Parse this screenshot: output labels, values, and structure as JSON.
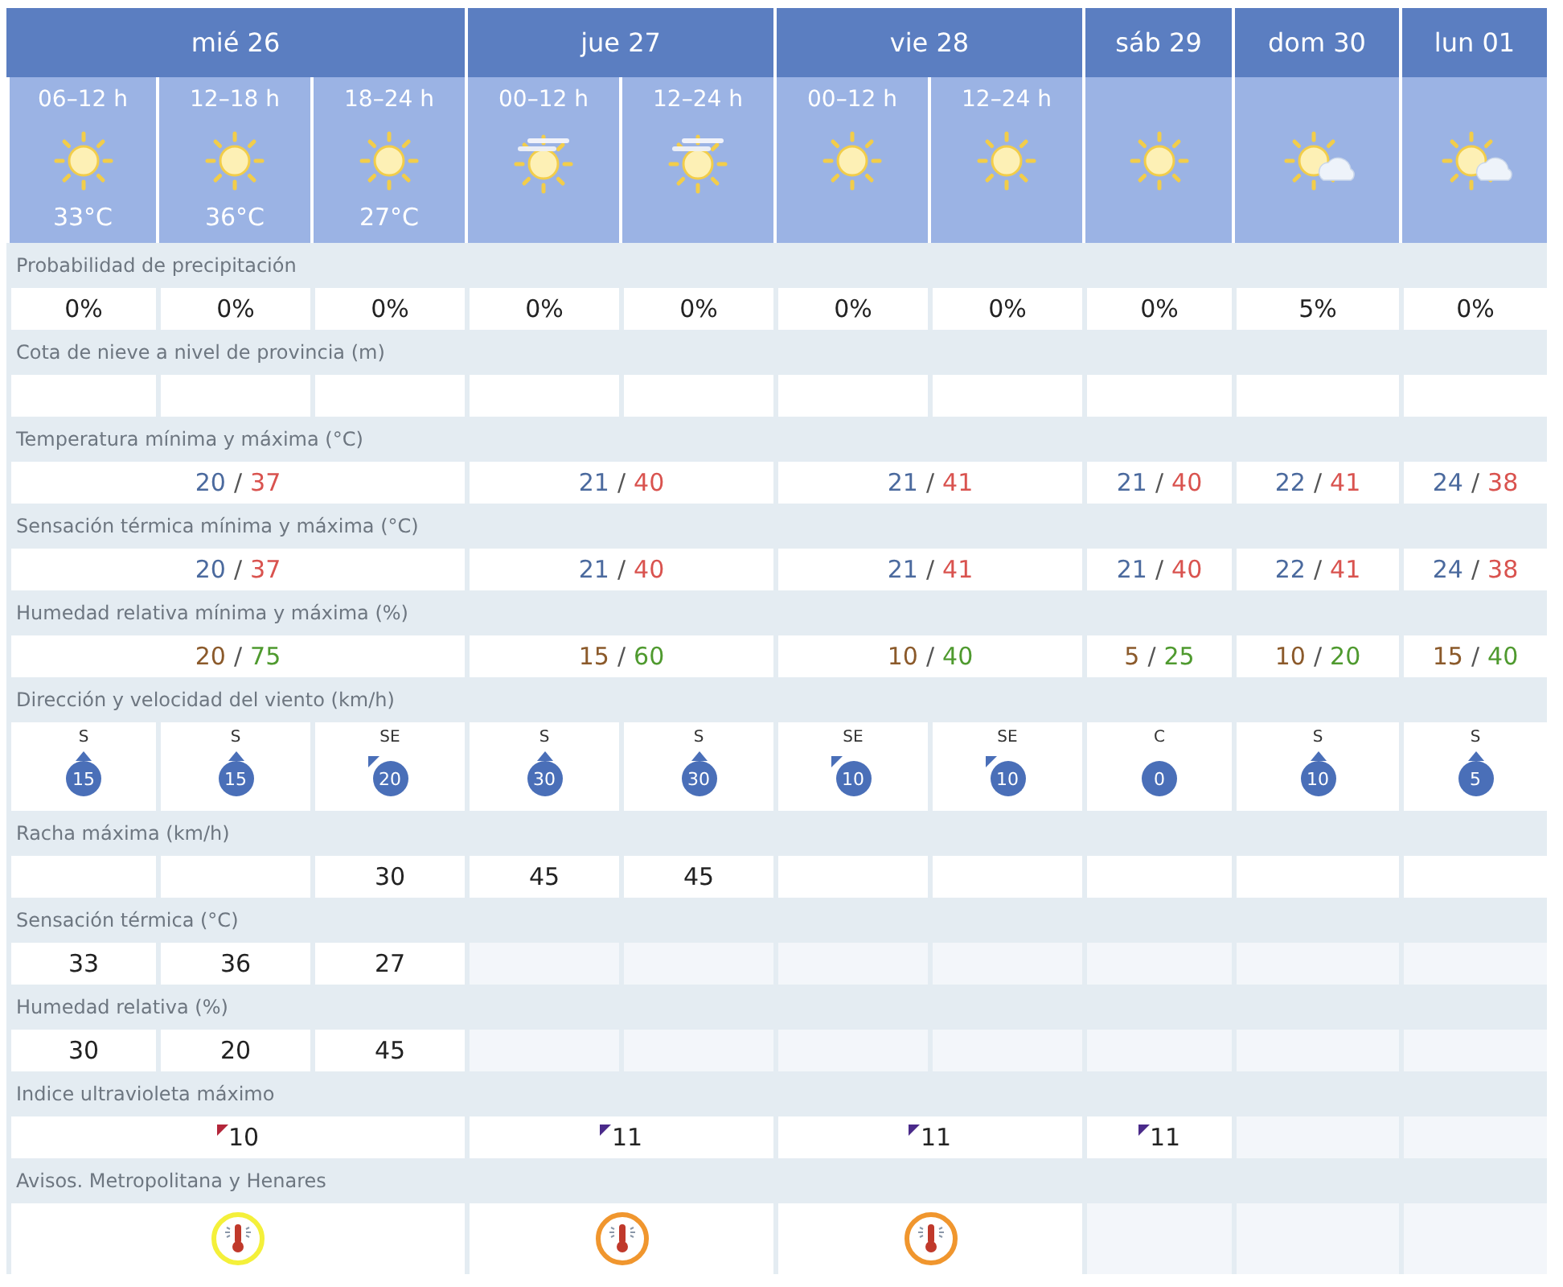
{
  "days": [
    {
      "label": "mié 26",
      "periods": [
        {
          "label": "06–12 h",
          "kind": "sunny",
          "temp": "33°C"
        },
        {
          "label": "12–18 h",
          "kind": "sunny",
          "temp": "36°C"
        },
        {
          "label": "18–24 h",
          "kind": "sunny",
          "temp": "27°C"
        }
      ]
    },
    {
      "label": "jue 27",
      "periods": [
        {
          "label": "00–12 h",
          "kind": "hazy"
        },
        {
          "label": "12–24 h",
          "kind": "hazy"
        }
      ]
    },
    {
      "label": "vie 28",
      "periods": [
        {
          "label": "00–12 h",
          "kind": "sunny"
        },
        {
          "label": "12–24 h",
          "kind": "sunny"
        }
      ]
    },
    {
      "label": "sáb 29",
      "periods": [
        {
          "kind": "sunny"
        }
      ]
    },
    {
      "label": "dom 30",
      "periods": [
        {
          "kind": "cloudy"
        }
      ]
    },
    {
      "label": "lun 01",
      "periods": [
        {
          "kind": "cloudy"
        }
      ]
    }
  ],
  "rows": [
    {
      "title": "Probabilidad de precipitación",
      "kind": "columns",
      "cells": [
        {
          "value": "0%",
          "na": false
        },
        {
          "value": "0%",
          "na": false
        },
        {
          "value": "0%",
          "na": false
        },
        {
          "value": "0%",
          "na": false
        },
        {
          "value": "0%",
          "na": false
        },
        {
          "value": "0%",
          "na": false
        },
        {
          "value": "0%",
          "na": false
        },
        {
          "value": "0%",
          "na": false
        },
        {
          "value": "5%",
          "na": false
        },
        {
          "value": "0%",
          "na": false
        }
      ]
    },
    {
      "title": "Cota de nieve a nivel de provincia (m)",
      "kind": "columns",
      "cells": [
        {
          "na": false
        },
        {
          "na": false
        },
        {
          "na": false
        },
        {
          "na": false
        },
        {
          "na": false
        },
        {
          "na": false
        },
        {
          "na": false
        },
        {
          "na": false
        },
        {
          "na": false
        },
        {
          "na": false
        }
      ]
    },
    {
      "title": "Temperatura mínima y máxima (°C)",
      "kind": "temperature",
      "cells": [
        {
          "min": "20",
          "sep": "/",
          "max": "37",
          "na": false
        },
        {
          "min": "21",
          "sep": "/",
          "max": "40",
          "na": false
        },
        {
          "min": "21",
          "sep": "/",
          "max": "41",
          "na": false
        },
        {
          "min": "21",
          "sep": "/",
          "max": "40",
          "na": false
        },
        {
          "min": "22",
          "sep": "/",
          "max": "41",
          "na": false
        },
        {
          "min": "24",
          "sep": "/",
          "max": "38",
          "na": false
        }
      ]
    },
    {
      "title": "Sensación térmica mínima y máxima (°C)",
      "kind": "temperature",
      "cells": [
        {
          "min": "20",
          "sep": "/",
          "max": "37",
          "na": false
        },
        {
          "min": "21",
          "sep": "/",
          "max": "40",
          "na": false
        },
        {
          "min": "21",
          "sep": "/",
          "max": "41",
          "na": false
        },
        {
          "min": "21",
          "sep": "/",
          "max": "40",
          "na": false
        },
        {
          "min": "22",
          "sep": "/",
          "max": "41",
          "na": false
        },
        {
          "min": "24",
          "sep": "/",
          "max": "38",
          "na": false
        }
      ]
    },
    {
      "title": "Humedad relativa mínima y máxima (%)",
      "kind": "humidity",
      "cells": [
        {
          "min": "20",
          "sep": "/",
          "max": "75",
          "na": false
        },
        {
          "min": "15",
          "sep": "/",
          "max": "60",
          "na": false
        },
        {
          "min": "10",
          "sep": "/",
          "max": "40",
          "na": false
        },
        {
          "min": "5",
          "sep": "/",
          "max": "25",
          "na": false
        },
        {
          "min": "10",
          "sep": "/",
          "max": "20",
          "na": false
        },
        {
          "min": "15",
          "sep": "/",
          "max": "40",
          "na": false
        }
      ]
    },
    {
      "title": "Dirección y velocidad del viento (km/h)",
      "kind": "wind",
      "cells": [
        {
          "direction": "S",
          "speed": "15",
          "kind": "south"
        },
        {
          "direction": "S",
          "speed": "15",
          "kind": "south"
        },
        {
          "direction": "SE",
          "speed": "20",
          "kind": "southeast"
        },
        {
          "direction": "S",
          "speed": "30",
          "kind": "south"
        },
        {
          "direction": "S",
          "speed": "30",
          "kind": "south"
        },
        {
          "direction": "SE",
          "speed": "10",
          "kind": "southeast"
        },
        {
          "direction": "SE",
          "speed": "10",
          "kind": "southeast"
        },
        {
          "direction": "C",
          "speed": "0",
          "kind": "calm"
        },
        {
          "direction": "S",
          "speed": "10",
          "kind": "south"
        },
        {
          "direction": "S",
          "speed": "5",
          "kind": "south"
        }
      ]
    },
    {
      "title": "Racha máxima (km/h)",
      "kind": "columns",
      "cells": [
        {
          "na": false
        },
        {
          "na": false
        },
        {
          "value": "30",
          "na": false
        },
        {
          "value": "45",
          "na": false
        },
        {
          "value": "45",
          "na": false
        },
        {
          "na": false
        },
        {
          "na": false
        },
        {
          "na": false
        },
        {
          "na": false
        },
        {
          "na": false
        }
      ]
    },
    {
      "title": "Sensación térmica (°C)",
      "kind": "columns",
      "cells": [
        {
          "value": "33",
          "na": false
        },
        {
          "value": "36",
          "na": false
        },
        {
          "value": "27",
          "na": false
        },
        {
          "na": true
        },
        {
          "na": true
        },
        {
          "na": true
        },
        {
          "na": true
        },
        {
          "na": true
        },
        {
          "na": true
        },
        {
          "na": true
        }
      ]
    },
    {
      "title": "Humedad relativa (%)",
      "kind": "columns",
      "cells": [
        {
          "value": "30",
          "na": false
        },
        {
          "value": "20",
          "na": false
        },
        {
          "value": "45",
          "na": false
        },
        {
          "na": true
        },
        {
          "na": true
        },
        {
          "na": true
        },
        {
          "na": true
        },
        {
          "na": true
        },
        {
          "na": true
        },
        {
          "na": true
        }
      ]
    },
    {
      "title": "Indice ultravioleta máximo",
      "kind": "uv",
      "cells": [
        {
          "value": "10",
          "color": "#b3263a",
          "na": false
        },
        {
          "value": "11",
          "color": "#4a2a8a",
          "na": false
        },
        {
          "value": "11",
          "color": "#4a2a8a",
          "na": false
        },
        {
          "value": "11",
          "color": "#4a2a8a",
          "na": false
        },
        {
          "na": true
        },
        {
          "na": true
        }
      ]
    },
    {
      "title": "Avisos. Metropolitana y Henares",
      "kind": "warning",
      "cells": [
        {
          "color": "#f4f03a",
          "na": false
        },
        {
          "color": "#f0962e",
          "na": false
        },
        {
          "color": "#f0962e",
          "na": false
        },
        {
          "na": true
        },
        {
          "na": true
        },
        {
          "na": true
        }
      ]
    }
  ]
}
